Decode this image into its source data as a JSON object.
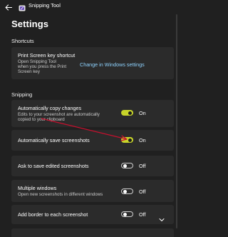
{
  "window": {
    "app_title": "Snipping Tool",
    "icons": {
      "back": "back-arrow-icon",
      "app": "snipping-tool-icon"
    }
  },
  "page_title": "Settings",
  "shortcuts": {
    "heading": "Shortcuts",
    "print_screen": {
      "title": "Print Screen key shortcut",
      "desc_line1": "Open Snipping Tool",
      "desc_line2": "when you press the Print",
      "desc_line3": "Screen key",
      "link": "Change in Windows settings"
    }
  },
  "snipping": {
    "heading": "Snipping",
    "items": [
      {
        "title": "Automatically copy changes",
        "desc_line1": "Edits to your screenshot are automatically",
        "desc_line2": "copied to your clipboard",
        "state": "On",
        "on": true
      },
      {
        "title": "Automatically save screenshots",
        "state": "On",
        "on": true
      },
      {
        "title": "Ask to save edited screenshots",
        "state": "Off",
        "on": false
      },
      {
        "title": "Multiple windows",
        "desc_line1": "Open new screenshots in different windows",
        "state": "Off",
        "on": false
      },
      {
        "title": "Add border to each screenshot",
        "state": "Off",
        "on": false
      }
    ]
  },
  "colors": {
    "toggle_on": "#c7d42a",
    "link": "#8fd3ff",
    "annotation_arrow": "#c8102e",
    "background": "#202020",
    "card": "#2b2b2b"
  }
}
